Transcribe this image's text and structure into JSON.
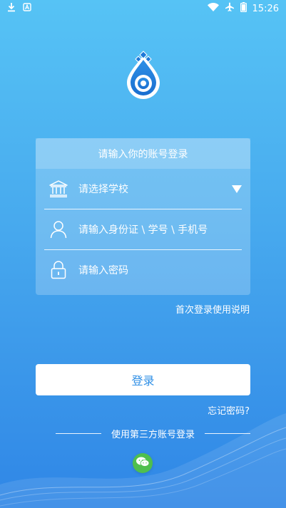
{
  "status_bar": {
    "time": "15:26",
    "icons": [
      "download-icon",
      "notification-icon",
      "wifi-icon",
      "airplane-icon",
      "battery-icon"
    ]
  },
  "login_card": {
    "header": "请输入你的账号登录",
    "school_select": {
      "placeholder": "请选择学校",
      "icon": "bank-icon"
    },
    "account_field": {
      "placeholder": "请输入身份证 \\ 学号 \\ 手机号",
      "icon": "user-icon"
    },
    "password_field": {
      "placeholder": "请输入密码",
      "icon": "lock-icon"
    }
  },
  "help_link": "首次登录使用说明",
  "login_button": "登录",
  "forgot_link": "忘记密码?",
  "third_party": {
    "label": "使用第三方账号登录",
    "icon": "wechat-icon"
  },
  "colors": {
    "accent": "#2f8fe6",
    "wechat": "#4fbf4e"
  }
}
